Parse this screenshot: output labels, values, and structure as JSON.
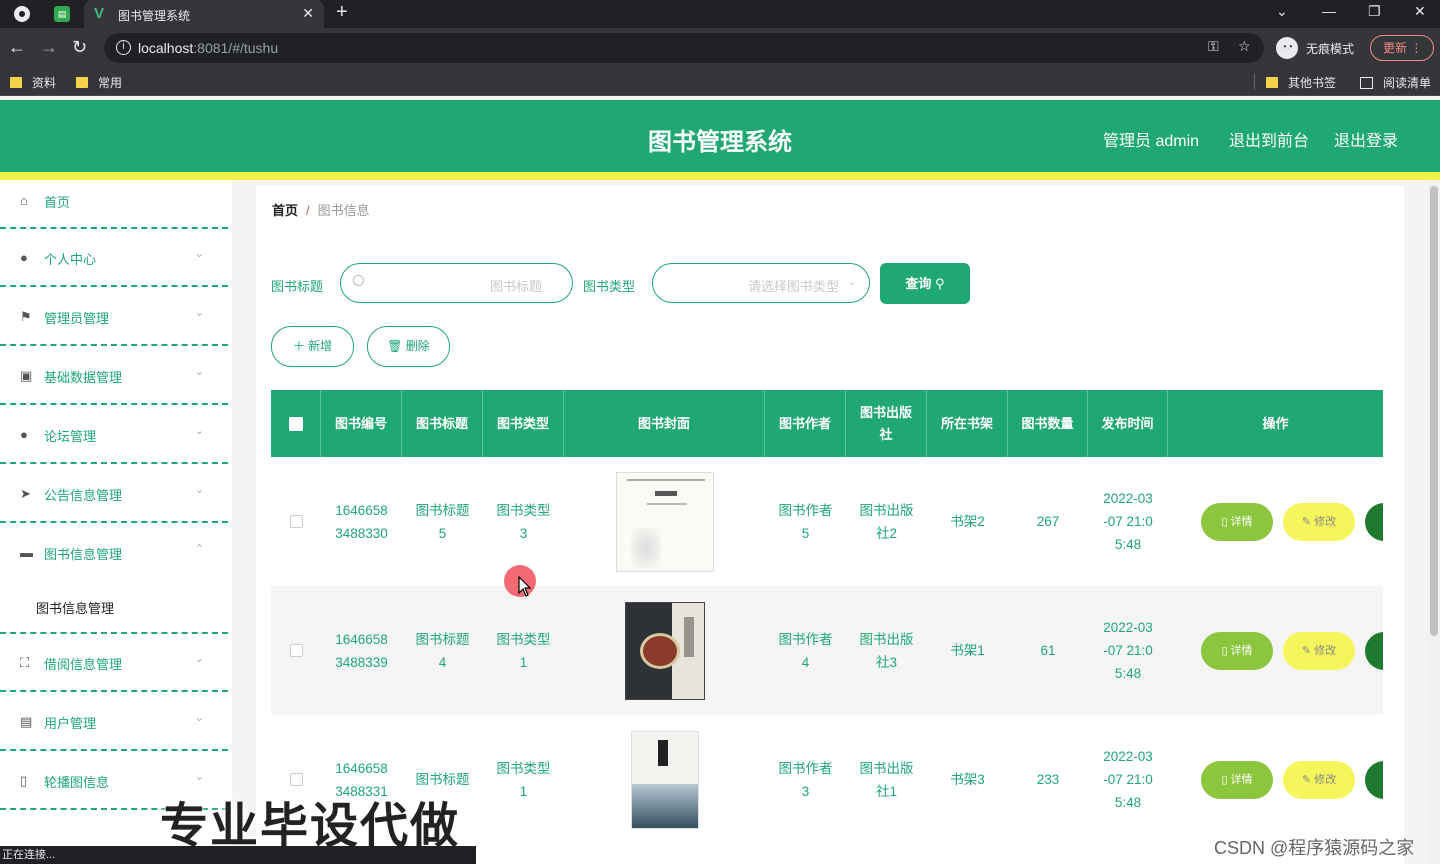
{
  "browser": {
    "tab_title": "图书管理系统",
    "url_host": "localhost",
    "url_rest": ":8081/#/tushu",
    "incognito_label": "无痕模式",
    "update_label": "更新",
    "bookmarks": [
      "资料",
      "常用"
    ],
    "other_bookmarks": "其他书签",
    "reading_list": "阅读清单",
    "status_text": "正在连接..."
  },
  "header": {
    "title": "图书管理系统",
    "admin_label": "管理员 admin",
    "back_front": "退出到前台",
    "logout": "退出登录"
  },
  "sidebar": {
    "items": [
      {
        "label": "首页",
        "icon": "home-icon"
      },
      {
        "label": "个人中心",
        "icon": "user-icon"
      },
      {
        "label": "管理员管理",
        "icon": "flag-icon"
      },
      {
        "label": "基础数据管理",
        "icon": "chart-icon"
      },
      {
        "label": "论坛管理",
        "icon": "user-icon"
      },
      {
        "label": "公告信息管理",
        "icon": "send-icon"
      },
      {
        "label": "图书信息管理",
        "icon": "book-icon"
      },
      {
        "label": "借阅信息管理",
        "icon": "expand-icon"
      },
      {
        "label": "用户管理",
        "icon": "clipboard-icon"
      },
      {
        "label": "轮播图信息",
        "icon": "mobile-icon"
      }
    ],
    "active_sub": "图书信息管理"
  },
  "breadcrumb": {
    "home": "首页",
    "sep": "/",
    "current": "图书信息"
  },
  "search": {
    "title_label": "图书标题",
    "title_placeholder": "图书标题",
    "type_label": "图书类型",
    "type_placeholder": "请选择图书类型",
    "query_button": "查询"
  },
  "actions": {
    "add": "＋ 新增",
    "delete": "🗑 删除"
  },
  "table": {
    "columns": [
      "图书编号",
      "图书标题",
      "图书类型",
      "图书封面",
      "图书作者",
      "图书出版社",
      "所在书架",
      "图书数量",
      "发布时间",
      "操作"
    ],
    "rows": [
      {
        "id": "1646658 3488330",
        "title": "图书标题 5",
        "type": "图书类型 3",
        "author": "图书作者 5",
        "publisher": "图书出版 社2",
        "shelf": "书架2",
        "count": "267",
        "time": "2022-03 -07 21:0 5:48"
      },
      {
        "id": "1646658 3488339",
        "title": "图书标题 4",
        "type": "图书类型 1",
        "author": "图书作者 4",
        "publisher": "图书出版 社3",
        "shelf": "书架1",
        "count": "61",
        "time": "2022-03 -07 21:0 5:48"
      },
      {
        "id": "1646658 3488331",
        "title": "图书标题",
        "type": "图书类型 1",
        "author": "图书作者 3",
        "publisher": "图书出版 社1",
        "shelf": "书架3",
        "count": "233",
        "time": "2022-03 -07 21:0 5:48"
      }
    ],
    "detail_label": "详情",
    "edit_label": "修改"
  },
  "overlay": {
    "watermark": "专业毕设代做",
    "csdn": "CSDN @程序猿源码之家"
  },
  "colors": {
    "primary": "#1fa774",
    "accent_yellow": "#f1f14a",
    "detail_green": "#8cc63f",
    "edit_yellow": "#f5f55c"
  }
}
